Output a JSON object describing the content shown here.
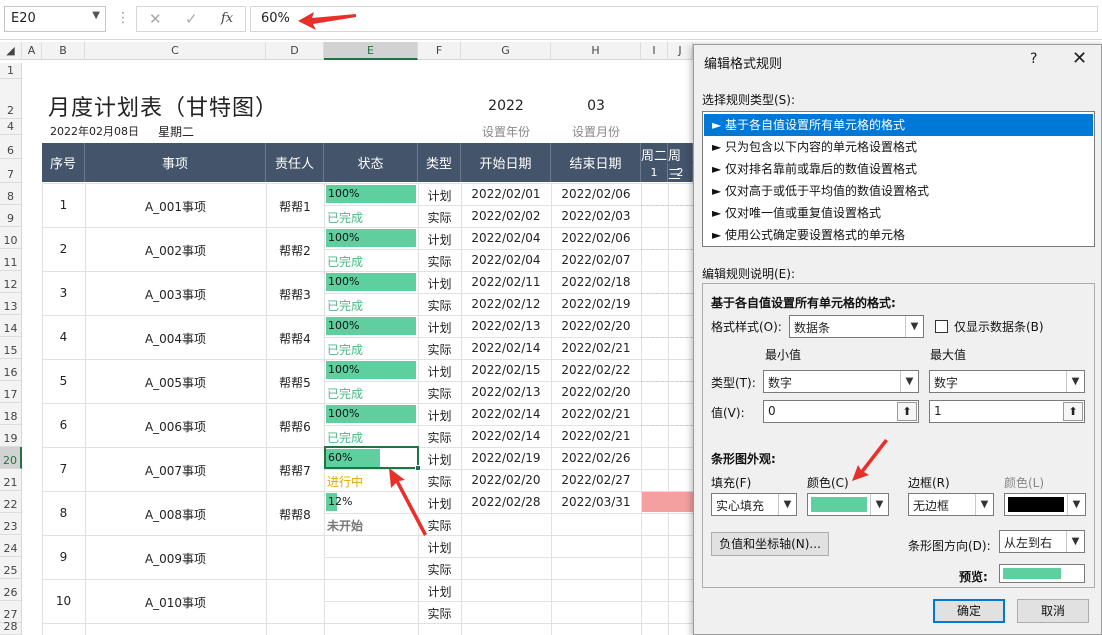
{
  "formula_bar": {
    "name_box": "E20",
    "fx": "fx",
    "value": "60%"
  },
  "columns": [
    "A",
    "B",
    "C",
    "D",
    "E",
    "F",
    "G",
    "H",
    "I",
    "J"
  ],
  "sheet": {
    "title": "月度计划表（甘特图）",
    "date": "2022年02月08日",
    "weekday": "星期二",
    "year": "2022",
    "month": "03",
    "year_label": "设置年份",
    "month_label": "设置月份",
    "headers": [
      "序号",
      "事项",
      "责任人",
      "状态",
      "类型",
      "开始日期",
      "结束日期"
    ],
    "week_headers": [
      "周二",
      "周三"
    ],
    "day_headers": [
      "1",
      "2"
    ],
    "row_numbers": [
      "1",
      "2",
      "4",
      "6",
      "7",
      "8",
      "9",
      "10",
      "11",
      "12",
      "13",
      "14",
      "15",
      "16",
      "17",
      "18",
      "19",
      "20",
      "21",
      "22",
      "23",
      "24",
      "25",
      "26",
      "27",
      "28"
    ],
    "tasks": [
      {
        "no": "1",
        "name": "A_001事项",
        "owner": "帮帮1",
        "progress": "100%",
        "progress_value": 1.0,
        "status": "已完成",
        "plan_start": "2022/02/01",
        "plan_end": "2022/02/06",
        "act_start": "2022/02/02",
        "act_end": "2022/02/03"
      },
      {
        "no": "2",
        "name": "A_002事项",
        "owner": "帮帮2",
        "progress": "100%",
        "progress_value": 1.0,
        "status": "已完成",
        "plan_start": "2022/02/04",
        "plan_end": "2022/02/06",
        "act_start": "2022/02/04",
        "act_end": "2022/02/07"
      },
      {
        "no": "3",
        "name": "A_003事项",
        "owner": "帮帮3",
        "progress": "100%",
        "progress_value": 1.0,
        "status": "已完成",
        "plan_start": "2022/02/11",
        "plan_end": "2022/02/18",
        "act_start": "2022/02/12",
        "act_end": "2022/02/19"
      },
      {
        "no": "4",
        "name": "A_004事项",
        "owner": "帮帮4",
        "progress": "100%",
        "progress_value": 1.0,
        "status": "已完成",
        "plan_start": "2022/02/13",
        "plan_end": "2022/02/20",
        "act_start": "2022/02/14",
        "act_end": "2022/02/21"
      },
      {
        "no": "5",
        "name": "A_005事项",
        "owner": "帮帮5",
        "progress": "100%",
        "progress_value": 1.0,
        "status": "已完成",
        "plan_start": "2022/02/15",
        "plan_end": "2022/02/22",
        "act_start": "2022/02/13",
        "act_end": "2022/02/20"
      },
      {
        "no": "6",
        "name": "A_006事项",
        "owner": "帮帮6",
        "progress": "100%",
        "progress_value": 1.0,
        "status": "已完成",
        "plan_start": "2022/02/14",
        "plan_end": "2022/02/21",
        "act_start": "2022/02/14",
        "act_end": "2022/02/21"
      },
      {
        "no": "7",
        "name": "A_007事项",
        "owner": "帮帮7",
        "progress": "60%",
        "progress_value": 0.6,
        "status": "进行中",
        "plan_start": "2022/02/19",
        "plan_end": "2022/02/26",
        "act_start": "2022/02/20",
        "act_end": "2022/02/27"
      },
      {
        "no": "8",
        "name": "A_008事项",
        "owner": "帮帮8",
        "progress": "12%",
        "progress_value": 0.12,
        "status": "未开始",
        "plan_start": "2022/02/28",
        "plan_end": "2022/03/31",
        "act_start": "",
        "act_end": ""
      },
      {
        "no": "9",
        "name": "A_009事项",
        "owner": "",
        "progress": "",
        "progress_value": 0,
        "status": "",
        "plan_start": "",
        "plan_end": "",
        "act_start": "",
        "act_end": ""
      },
      {
        "no": "10",
        "name": "A_010事项",
        "owner": "",
        "progress": "",
        "progress_value": 0,
        "status": "",
        "plan_start": "",
        "plan_end": "",
        "act_start": "",
        "act_end": ""
      }
    ],
    "type_plan": "计划",
    "type_actual": "实际",
    "colors": {
      "header_bg": "#44546a",
      "bar": "#5fcfa0",
      "done": "#4cb888",
      "inprogress": "#e6a800",
      "notstarted": "#777777",
      "gantt": "#f4a0a0"
    }
  },
  "dialog": {
    "title": "编辑格式规则",
    "help": "?",
    "close": "✕",
    "rule_type_label": "选择规则类型(S):",
    "rules": [
      "► 基于各自值设置所有单元格的格式",
      "► 只为包含以下内容的单元格设置格式",
      "► 仅对排名靠前或靠后的数值设置格式",
      "► 仅对高于或低于平均值的数值设置格式",
      "► 仅对唯一值或重复值设置格式",
      "► 使用公式确定要设置格式的单元格"
    ],
    "edit_desc_label": "编辑规则说明(E):",
    "group_title": "基于各自值设置所有单元格的格式:",
    "format_style_label": "格式样式(O):",
    "format_style_value": "数据条",
    "show_bar_only": "仅显示数据条(B)",
    "min_label": "最小值",
    "max_label": "最大值",
    "type_label": "类型(T):",
    "min_type": "数字",
    "max_type": "数字",
    "value_label": "值(V):",
    "min_value": "0",
    "max_value": "1",
    "appearance_label": "条形图外观:",
    "fill_label": "填充(F)",
    "color_label": "颜色(C)",
    "border_label": "边框(R)",
    "border_color_label": "颜色(L)",
    "fill_value": "实心填充",
    "border_value": "无边框",
    "fill_color": "#5fcfa0",
    "border_color": "#000000",
    "axis_button": "负值和坐标轴(N)...",
    "direction_label": "条形图方向(D):",
    "direction_value": "从左到右",
    "preview_label": "预览:",
    "ok": "确定",
    "cancel": "取消"
  }
}
